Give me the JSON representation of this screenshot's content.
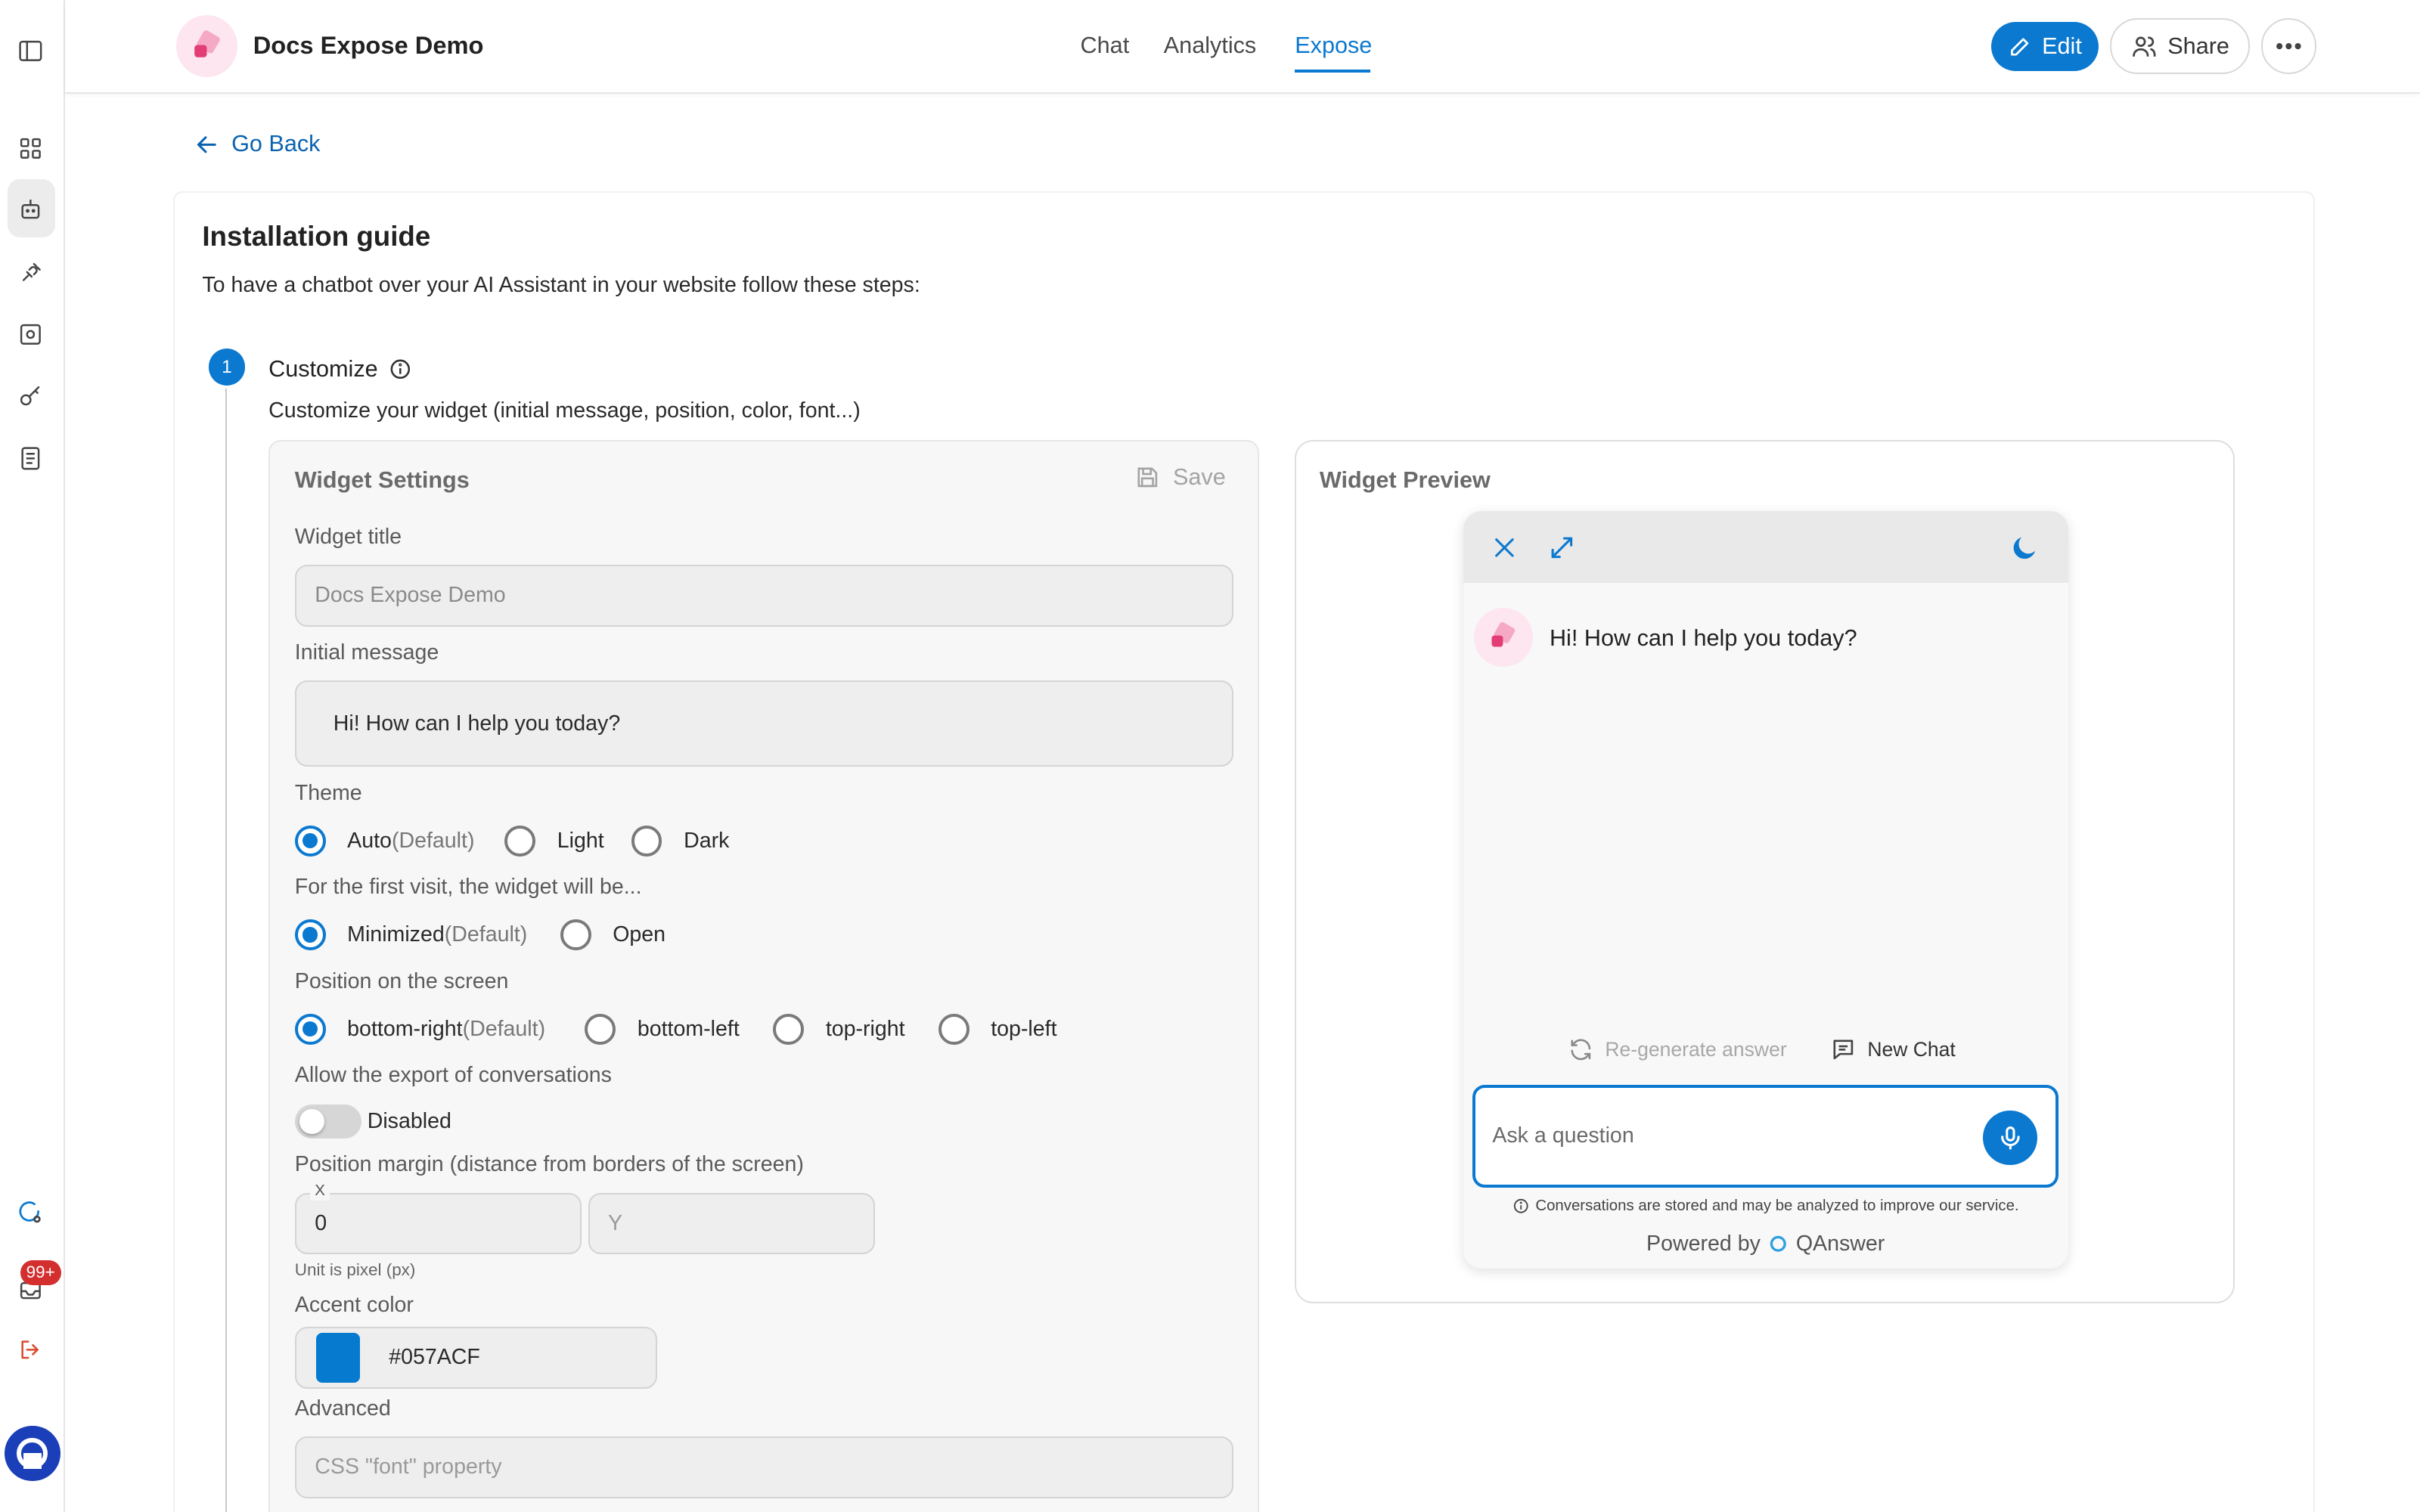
{
  "app": {
    "title": "Docs Expose Demo"
  },
  "nav": {
    "tabs": [
      {
        "label": "Chat"
      },
      {
        "label": "Analytics"
      },
      {
        "label": "Expose"
      }
    ]
  },
  "header": {
    "edit_label": "Edit",
    "share_label": "Share"
  },
  "sidebar": {
    "badge": "99+"
  },
  "page": {
    "go_back": "Go Back",
    "title": "Installation guide",
    "description": "To have a chatbot over your AI Assistant in your website follow these steps:",
    "step_number": "1",
    "step_title": "Customize",
    "step_description": "Customize your widget (initial message, position, color, font...)"
  },
  "settings": {
    "title": "Widget Settings",
    "save_label": "Save",
    "widget_title_label": "Widget title",
    "widget_title_placeholder": "Docs Expose Demo",
    "initial_message_label": "Initial message",
    "initial_message_value": "Hi! How can I help you today?",
    "theme_label": "Theme",
    "theme_options": [
      {
        "label": "Auto",
        "suffix": "(Default)",
        "selected": true
      },
      {
        "label": "Light",
        "selected": false
      },
      {
        "label": "Dark",
        "selected": false
      }
    ],
    "first_visit_label": "For the first visit, the widget will be...",
    "first_visit_options": [
      {
        "label": "Minimized",
        "suffix": "(Default)",
        "selected": true
      },
      {
        "label": "Open",
        "selected": false
      }
    ],
    "position_label": "Position on the screen",
    "position_options": [
      {
        "label": "bottom-right",
        "suffix": "(Default)",
        "selected": true
      },
      {
        "label": "bottom-left",
        "selected": false
      },
      {
        "label": "top-right",
        "selected": false
      },
      {
        "label": "top-left",
        "selected": false
      }
    ],
    "export_label": "Allow the export of conversations",
    "export_state": "Disabled",
    "margin_label": "Position margin (distance from borders of the screen)",
    "margin_x_label": "X",
    "margin_x_value": "0",
    "margin_y_placeholder": "Y",
    "unit_note": "Unit is pixel (px)",
    "accent_label": "Accent color",
    "accent_color": "#057ACF",
    "advanced_label": "Advanced",
    "font_placeholder": "CSS \"font\" property"
  },
  "preview": {
    "title": "Widget Preview",
    "message": "Hi! How can I help you today?",
    "regenerate_label": "Re-generate answer",
    "new_chat_label": "New Chat",
    "input_placeholder": "Ask a question",
    "disclaimer": "Conversations are stored and may be analyzed to improve our service.",
    "powered_by": "Powered by",
    "brand": "QAnswer"
  },
  "colors": {
    "accent": "#0b79d0",
    "badge": "#d32f2f",
    "logout": "#d9472b"
  }
}
